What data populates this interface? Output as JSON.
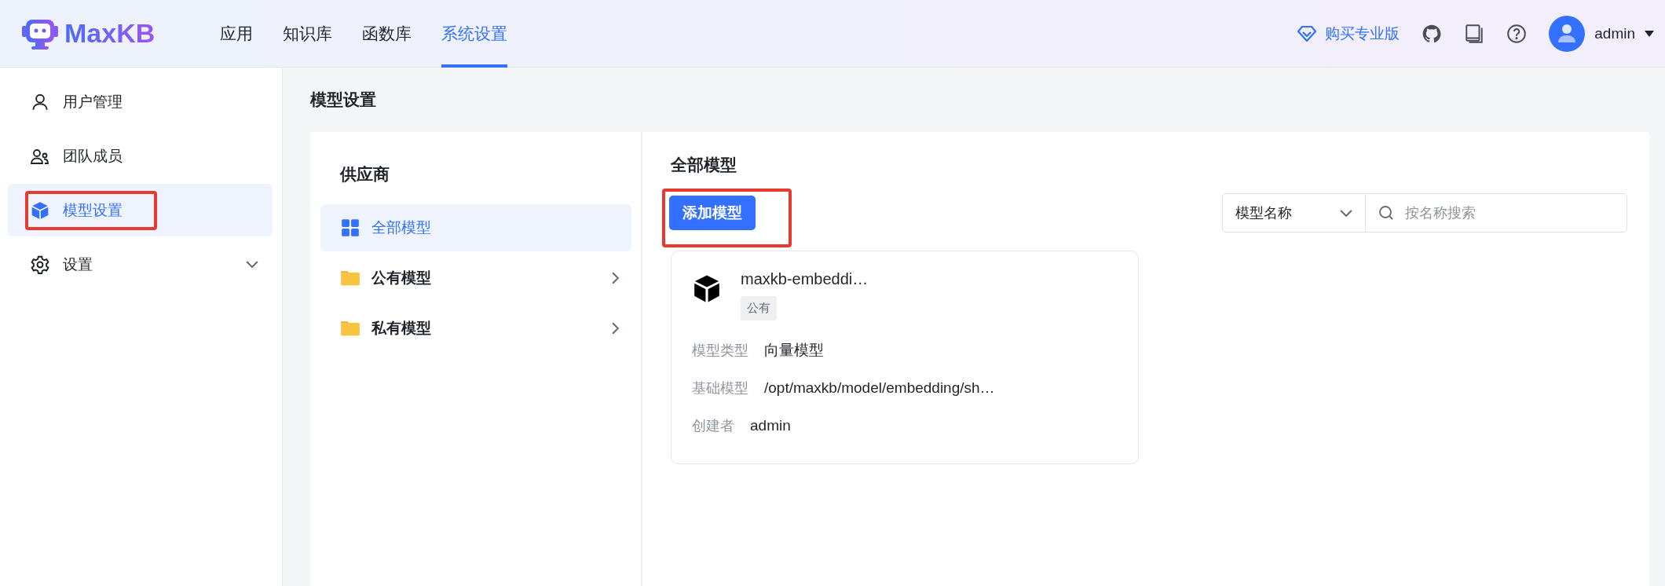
{
  "header": {
    "logo": "MaxKB",
    "nav": [
      {
        "label": "应用",
        "selected": false
      },
      {
        "label": "知识库",
        "selected": false
      },
      {
        "label": "函数库",
        "selected": false
      },
      {
        "label": "系统设置",
        "selected": true
      }
    ],
    "upgrade": "购买专业版",
    "user": "admin"
  },
  "sidebar": {
    "items": [
      {
        "label": "用户管理",
        "kind": "user",
        "selected": false,
        "highlighted": false,
        "expandable": false
      },
      {
        "label": "团队成员",
        "kind": "team",
        "selected": false,
        "highlighted": false,
        "expandable": false
      },
      {
        "label": "模型设置",
        "kind": "cube",
        "selected": true,
        "highlighted": true,
        "expandable": false
      },
      {
        "label": "设置",
        "kind": "gear",
        "selected": false,
        "highlighted": false,
        "expandable": true
      }
    ]
  },
  "page_title": "模型设置",
  "providers": {
    "title": "供应商",
    "items": [
      {
        "label": "全部模型",
        "kind": "grid",
        "selected": true,
        "expandable": false
      },
      {
        "label": "公有模型",
        "kind": "folder",
        "selected": false,
        "expandable": true
      },
      {
        "label": "私有模型",
        "kind": "folder",
        "selected": false,
        "expandable": true
      }
    ]
  },
  "models": {
    "title": "全部模型",
    "add_button": {
      "label": "添加模型",
      "highlighted": true
    },
    "filter": {
      "value": "模型名称"
    },
    "search": {
      "placeholder": "按名称搜索"
    },
    "cards": [
      {
        "name": "maxkb-embeddi…",
        "tag": "公有",
        "fields": [
          {
            "label": "模型类型",
            "value": "向量模型"
          },
          {
            "label": "基础模型",
            "value": "/opt/maxkb/model/embedding/sh…"
          },
          {
            "label": "创建者",
            "value": "admin"
          }
        ]
      }
    ]
  }
}
